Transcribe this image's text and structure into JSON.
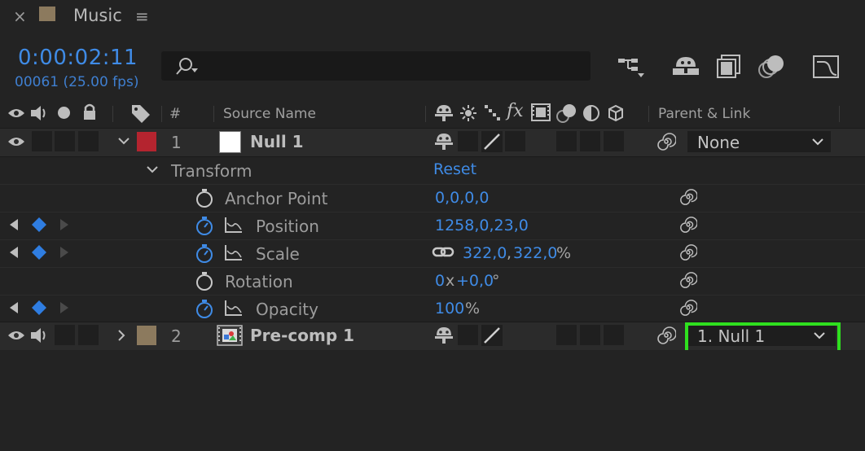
{
  "tab": {
    "close_glyph": "×",
    "title": "Music",
    "menu_glyph": "≡",
    "swatch_color": "#8c7a5e"
  },
  "time": {
    "timecode": "0:00:02:11",
    "frame_info": "00061 (25.00 fps)"
  },
  "search": {
    "placeholder": ""
  },
  "toolbar": {
    "icons": [
      "composition-flowchart-icon",
      "draft-3d-icon",
      "frame-blending-icon",
      "motion-blur-icon",
      "graph-editor-icon"
    ]
  },
  "columns": {
    "number": "#",
    "source_name": "Source Name",
    "parent_link": "Parent & Link"
  },
  "layers": [
    {
      "number": "1",
      "name": "Null 1",
      "label_color": "#b4242f",
      "parent": "None",
      "expanded": true
    },
    {
      "number": "2",
      "name": "Pre-comp 1",
      "label_color": "#8c7a5e",
      "parent": "1. Null 1",
      "expanded": false
    }
  ],
  "transform": {
    "label": "Transform",
    "reset": "Reset",
    "properties": [
      {
        "name": "Anchor Point",
        "value": "0,0,0,0",
        "keyframed": false
      },
      {
        "name": "Position",
        "value": "1258,0,23,0",
        "keyframed": true
      },
      {
        "name": "Scale",
        "value_a": "322,0",
        "comma": ",",
        "value_b": "322,0",
        "suffix": "%",
        "keyframed": true
      },
      {
        "name": "Rotation",
        "value_a": "0",
        "mid": "x",
        "value_b": "+0,0",
        "suffix": "°",
        "keyframed": false
      },
      {
        "name": "Opacity",
        "value": "100",
        "suffix": "%",
        "keyframed": true
      }
    ]
  },
  "highlight_color": "#2fe01f"
}
